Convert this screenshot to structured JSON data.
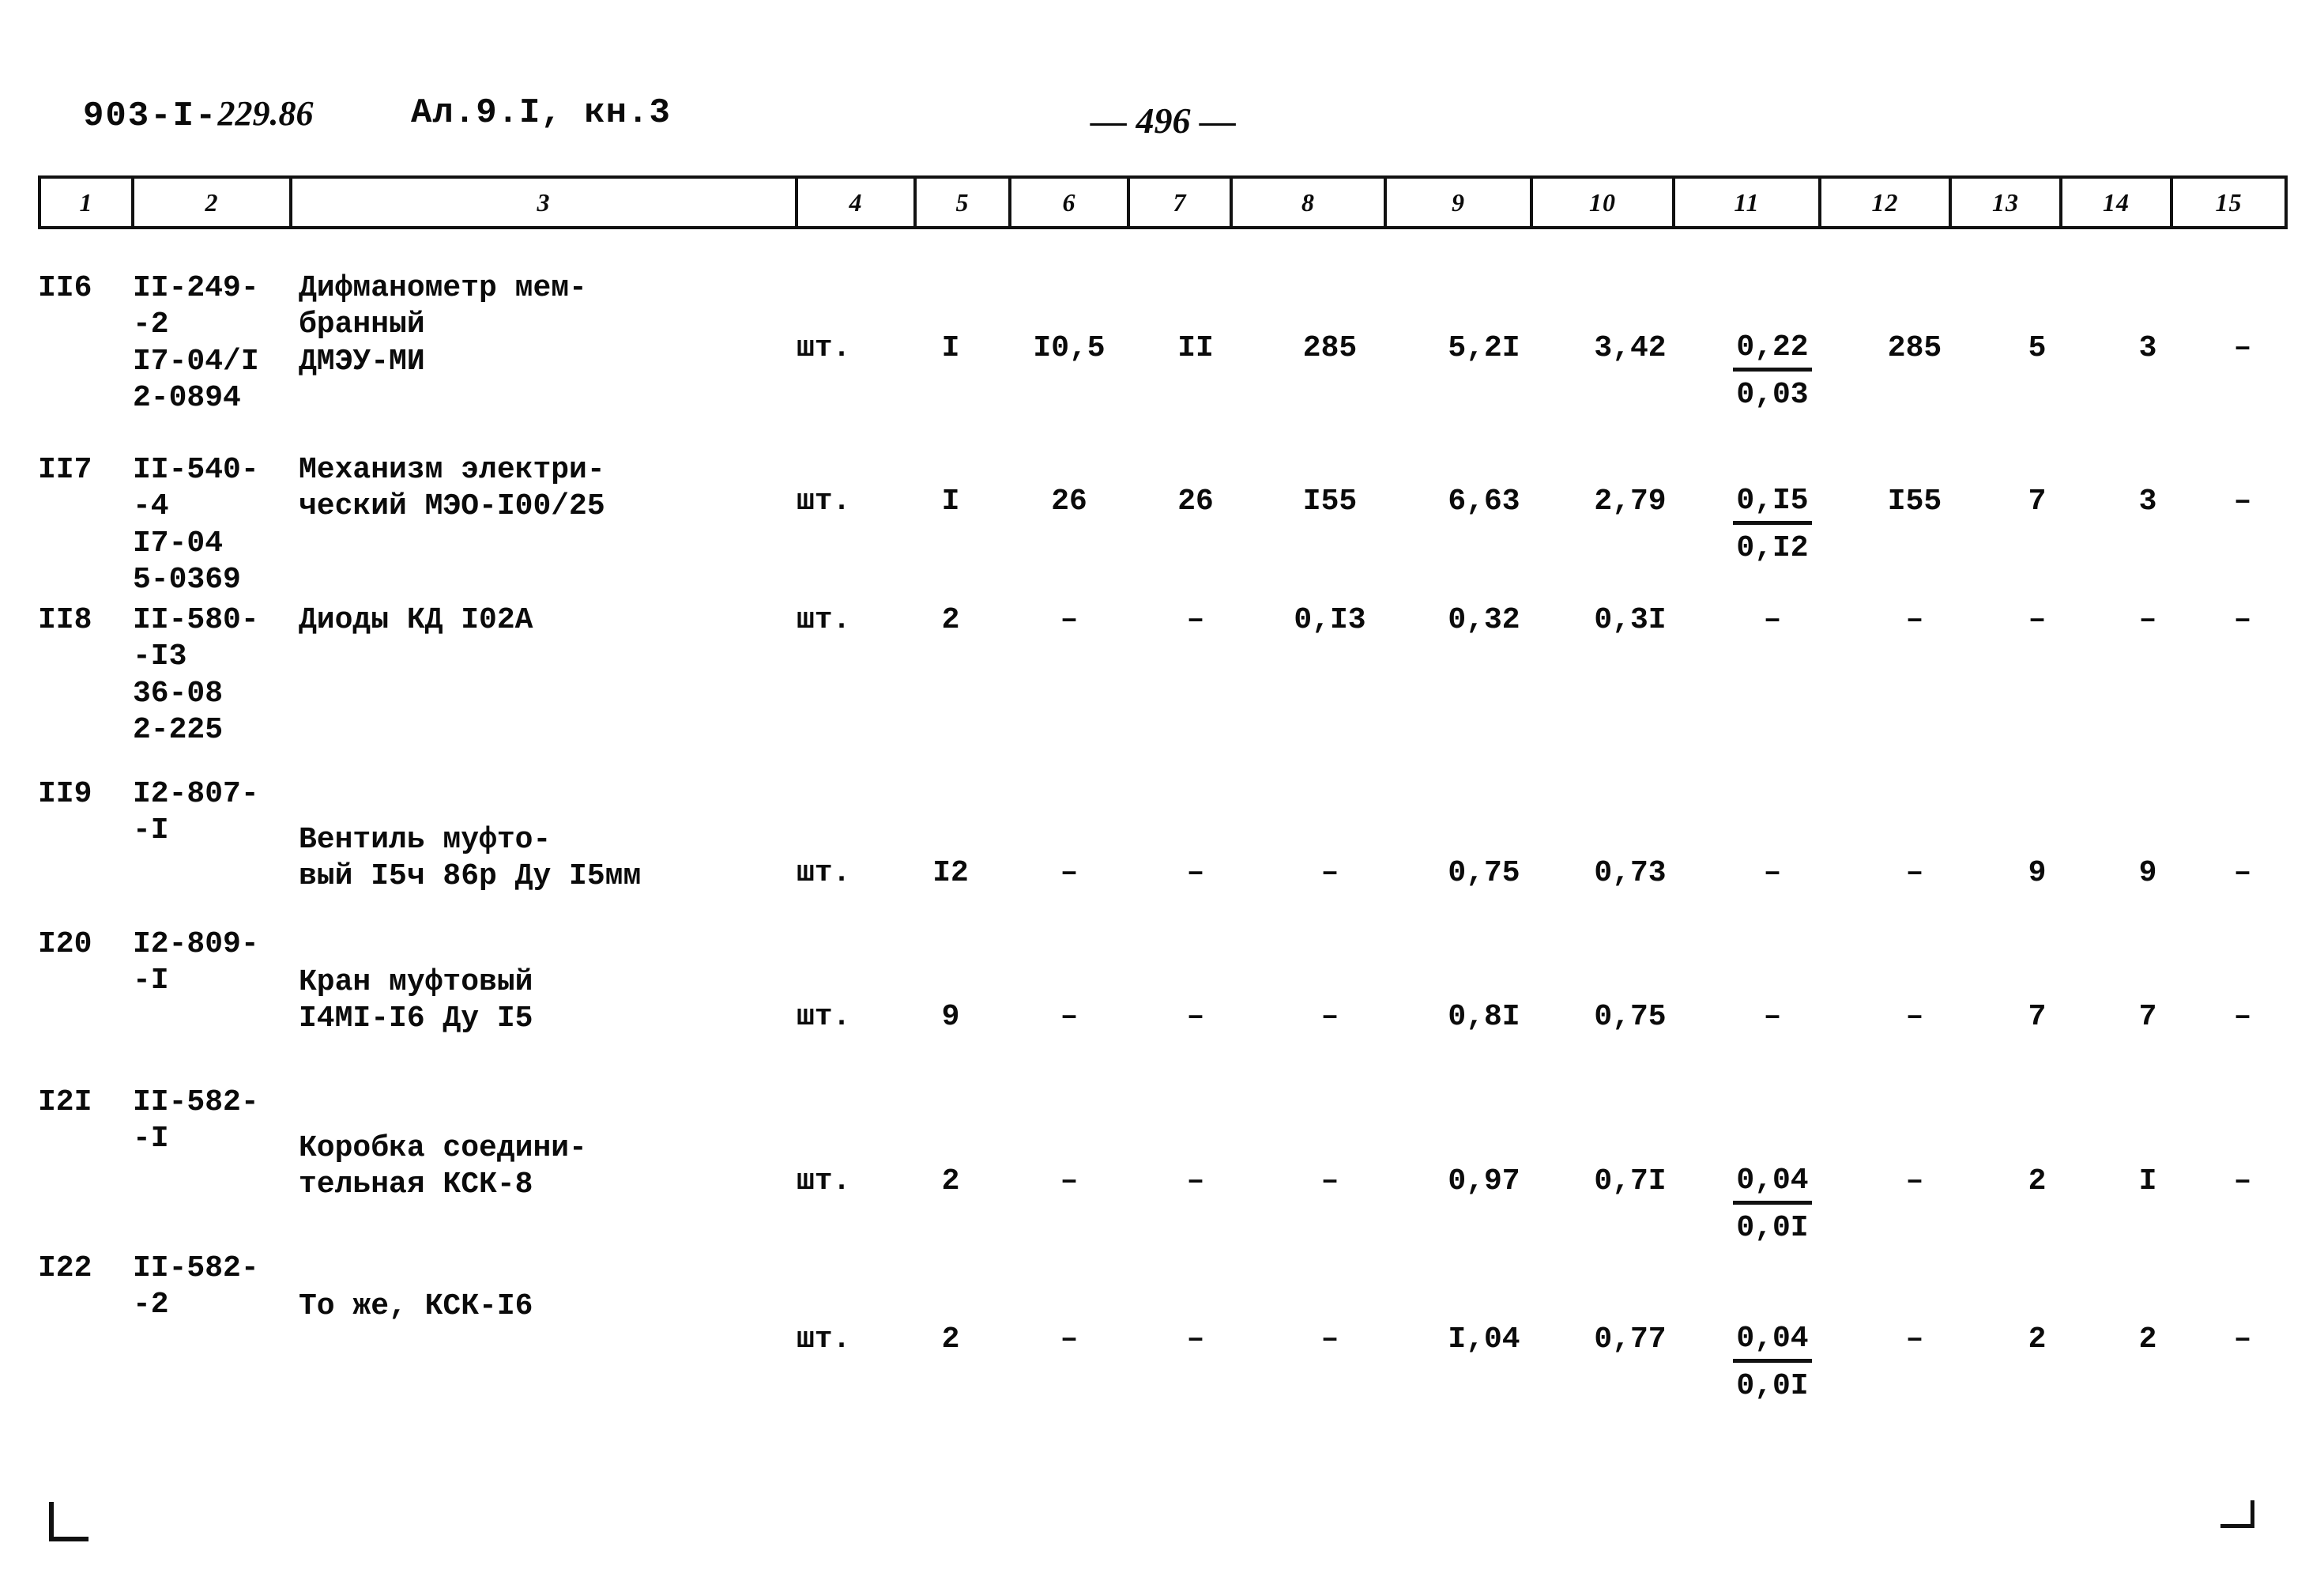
{
  "header": {
    "doc_code_prefix": "903-I-",
    "doc_code_hand": "229.86",
    "album_ref": "Ал.9.I, кн.3",
    "page_number": "— 496 —"
  },
  "table": {
    "column_headers": [
      "1",
      "2",
      "3",
      "4",
      "5",
      "6",
      "7",
      "8",
      "9",
      "10",
      "11",
      "12",
      "13",
      "14",
      "15"
    ],
    "rows": [
      {
        "pos": "II6",
        "code_lines": [
          "II-249-",
          "-2",
          "I7-04/I",
          "2-0894"
        ],
        "code": "II-249-\n-2\nI7-04/I\n2-0894",
        "name": "Дифманометр мем-\nбранный\nДМЭУ-МИ",
        "unit": "шт.",
        "qty": "I",
        "c6": "I0,5",
        "c7": "II",
        "c8": "285",
        "c9": "5,2I",
        "c10": "3,42",
        "c11_num": "0,22",
        "c11_den": "0,03",
        "c12": "285",
        "c13": "5",
        "c14": "3",
        "c15": "–"
      },
      {
        "pos": "II7",
        "code_lines": [
          "II-540-",
          "-4",
          "I7-04",
          "5-0369"
        ],
        "code": "II-540-\n-4\nI7-04\n5-0369",
        "name": "Механизм электри-\nческий МЭО-I00/25",
        "unit": "шт.",
        "qty": "I",
        "c6": "26",
        "c7": "26",
        "c8": "I55",
        "c9": "6,63",
        "c10": "2,79",
        "c11_num": "0,I5",
        "c11_den": "0,I2",
        "c12": "I55",
        "c13": "7",
        "c14": "3",
        "c15": "–"
      },
      {
        "pos": "II8",
        "code_lines": [
          "II-580-",
          "-I3",
          "36-08",
          "2-225"
        ],
        "code": "II-580-\n-I3\n36-08\n2-225",
        "name": "Диоды КД I02А",
        "unit": "шт.",
        "qty": "2",
        "c6": "–",
        "c7": "–",
        "c8": "0,I3",
        "c9": "0,32",
        "c10": "0,3I",
        "c11_num": "–",
        "c11_den": "",
        "c12": "–",
        "c13": "–",
        "c14": "–",
        "c15": "–"
      },
      {
        "pos": "II9",
        "code_lines": [
          "I2-807-",
          "-I"
        ],
        "code": "I2-807-\n-I",
        "name": "Вентиль муфто-\nвый I5ч 86р Ду I5мм",
        "unit": "шт.",
        "qty": "I2",
        "c6": "–",
        "c7": "–",
        "c8": "–",
        "c9": "0,75",
        "c10": "0,73",
        "c11_num": "–",
        "c11_den": "",
        "c12": "–",
        "c13": "9",
        "c14": "9",
        "c15": "–"
      },
      {
        "pos": "I20",
        "code_lines": [
          "I2-809-",
          "-I"
        ],
        "code": "I2-809-\n-I",
        "name": "Кран муфтовый\nI4МI-I6 Ду I5",
        "unit": "шт.",
        "qty": "9",
        "c6": "–",
        "c7": "–",
        "c8": "–",
        "c9": "0,8I",
        "c10": "0,75",
        "c11_num": "–",
        "c11_den": "",
        "c12": "–",
        "c13": "7",
        "c14": "7",
        "c15": "–"
      },
      {
        "pos": "I2I",
        "code_lines": [
          "II-582-",
          "-I"
        ],
        "code": "II-582-\n-I",
        "name": "Коробка соедини-\nтельная КСК-8",
        "unit": "шт.",
        "qty": "2",
        "c6": "–",
        "c7": "–",
        "c8": "–",
        "c9": "0,97",
        "c10": "0,7I",
        "c11_num": "0,04",
        "c11_den": "0,0I",
        "c12": "–",
        "c13": "2",
        "c14": "I",
        "c15": "–"
      },
      {
        "pos": "I22",
        "code_lines": [
          "II-582-",
          "-2"
        ],
        "code": "II-582-\n-2",
        "name": "То же, КСК-I6",
        "unit": "шт.",
        "qty": "2",
        "c6": "–",
        "c7": "–",
        "c8": "–",
        "c9": "I,04",
        "c10": "0,77",
        "c11_num": "0,04",
        "c11_den": "0,0I",
        "c12": "–",
        "c13": "2",
        "c14": "2",
        "c15": "–"
      }
    ]
  }
}
